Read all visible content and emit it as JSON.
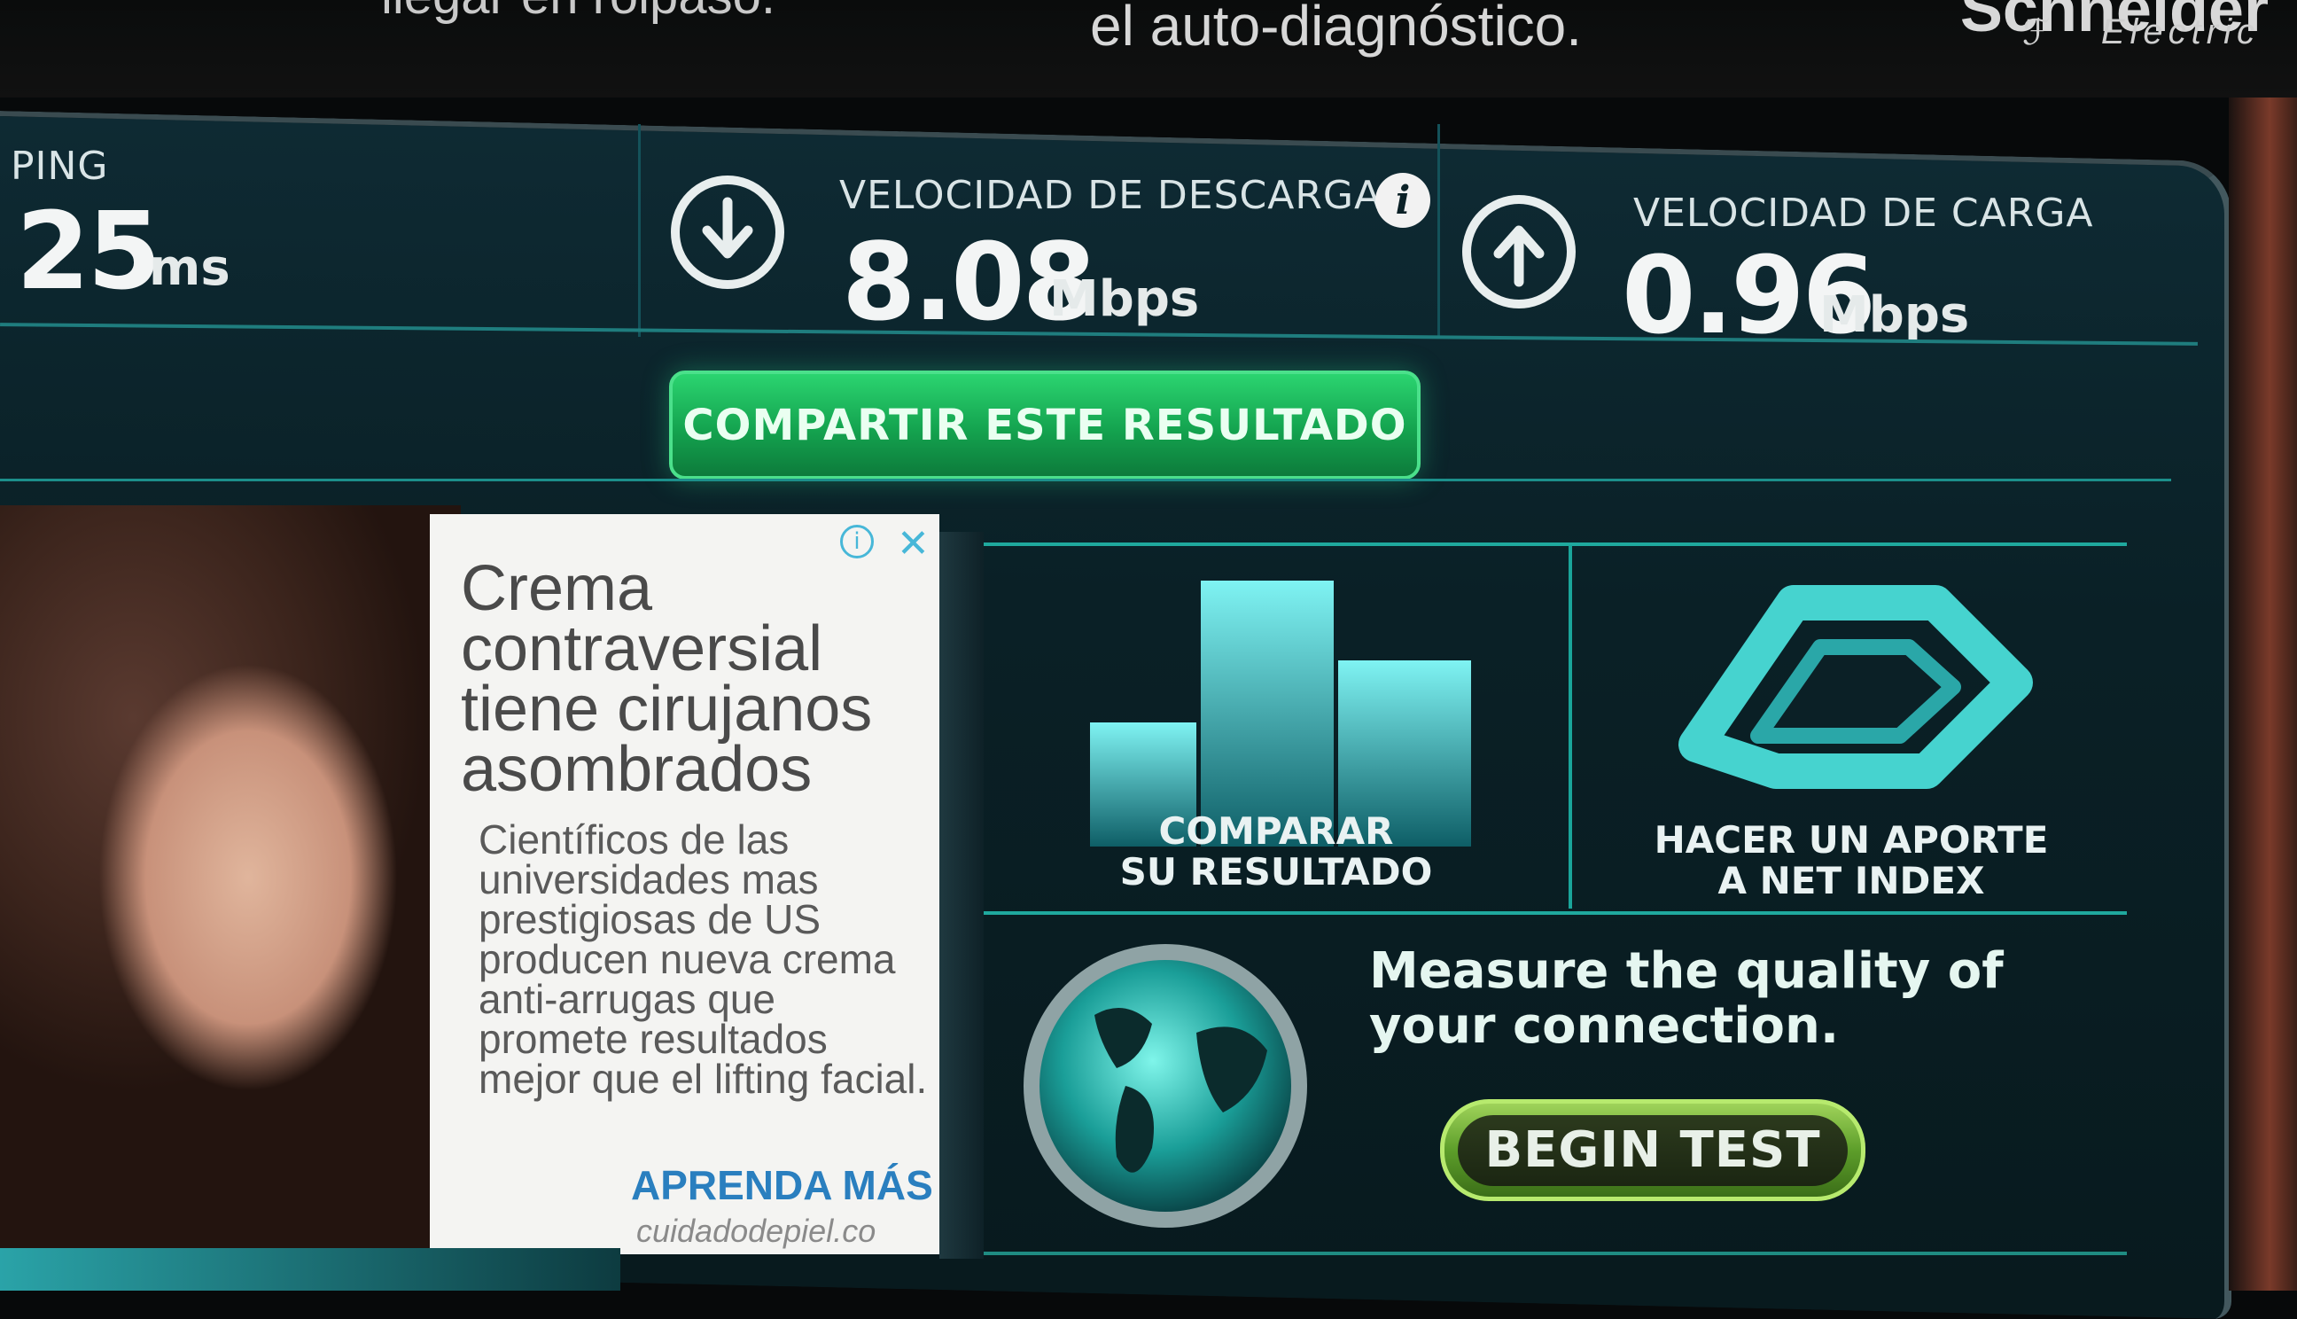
{
  "header": {
    "caption_left": "llegar en rolpaso.",
    "caption": "el auto-diagnóstico.",
    "brand_name": "Schneider",
    "brand_sub": "Electric"
  },
  "stats": {
    "ping": {
      "label": "PING",
      "value": "25",
      "unit": "ms"
    },
    "download": {
      "label": "VELOCIDAD DE DESCARGA",
      "value": "8.08",
      "unit": "Mbps",
      "info_icon": "i"
    },
    "upload": {
      "label": "VELOCIDAD DE CARGA",
      "value": "0.96",
      "unit": "Mbps"
    }
  },
  "share_button": "COMPARTIR ESTE RESULTADO",
  "ad": {
    "headline": "Crema contraversial tiene cirujanos asombrados",
    "body": "Científicos de las universidades  mas prestigiosas de US producen nueva crema anti-arrugas que promete resultados mejor que el lifting facial.",
    "cta": "APRENDA MÁS »",
    "url": "cuidadodepiel.co",
    "info_icon": "i",
    "close_icon": "✕"
  },
  "tiles": {
    "compare": {
      "line1": "COMPARAR",
      "line2": "SU RESULTADO"
    },
    "netindex": {
      "line1": "HACER UN APORTE",
      "line2": "A NET INDEX"
    }
  },
  "begin": {
    "tagline_line1": "Measure the quality of",
    "tagline_line2": "your connection.",
    "button": "BEGIN TEST"
  },
  "colors": {
    "panel_bg": "#0a2026",
    "accent_teal": "#1fa99e",
    "share_green": "#14a34f",
    "begin_green": "#5d9e2a",
    "ad_link_blue": "#2a7fbf"
  }
}
